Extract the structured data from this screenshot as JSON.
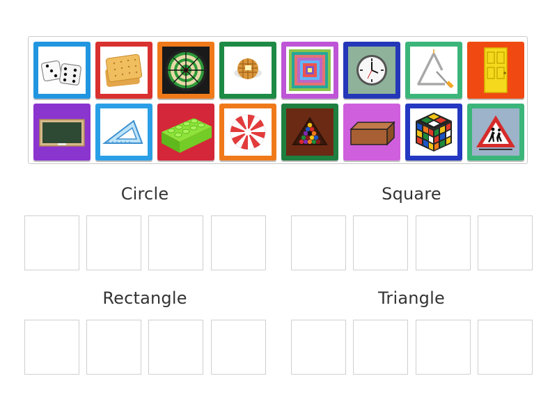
{
  "tray": {
    "tiles": [
      {
        "name": "dice-tile",
        "icon": "dice-icon",
        "frame": "#2196e0"
      },
      {
        "name": "crackers-tile",
        "icon": "crackers-icon",
        "frame": "#d9312f"
      },
      {
        "name": "dartboard-tile",
        "icon": "dartboard-icon",
        "frame": "#f07a1a"
      },
      {
        "name": "waffle-tile",
        "icon": "waffle-icon",
        "frame": "#1d8a45"
      },
      {
        "name": "concentric-squares-tile",
        "icon": "concentric-squares-icon",
        "frame": "#bd55d6"
      },
      {
        "name": "clock-tile",
        "icon": "clock-icon",
        "frame": "#2437b8"
      },
      {
        "name": "musical-triangle-tile",
        "icon": "musical-triangle-icon",
        "frame": "#3bb57a"
      },
      {
        "name": "door-tile",
        "icon": "door-icon",
        "frame": "#f04a12"
      },
      {
        "name": "chalkboard-tile",
        "icon": "chalkboard-icon",
        "frame": "#8b35cf"
      },
      {
        "name": "set-square-tile",
        "icon": "set-square-icon",
        "frame": "#2a9fe6"
      },
      {
        "name": "lego-brick-tile",
        "icon": "lego-brick-icon",
        "frame": "#d42739"
      },
      {
        "name": "peppermint-candy-tile",
        "icon": "peppermint-candy-icon",
        "frame": "#f07a1a"
      },
      {
        "name": "billiard-rack-tile",
        "icon": "billiard-rack-icon",
        "frame": "#1f7f3f"
      },
      {
        "name": "brick-tile",
        "icon": "brick-icon",
        "frame": "#cf5fdc"
      },
      {
        "name": "rubiks-cube-tile",
        "icon": "rubiks-cube-icon",
        "frame": "#2438c2"
      },
      {
        "name": "warning-sign-tile",
        "icon": "warning-sign-icon",
        "frame": "#3bb57a"
      }
    ]
  },
  "groups": {
    "circle": {
      "title": "Circle"
    },
    "square": {
      "title": "Square"
    },
    "rectangle": {
      "title": "Rectangle"
    },
    "triangle": {
      "title": "Triangle"
    }
  },
  "colors": {
    "tray_border": "#c8c8c8",
    "slot_border": "#cfcfcf",
    "title_text": "#333333"
  }
}
